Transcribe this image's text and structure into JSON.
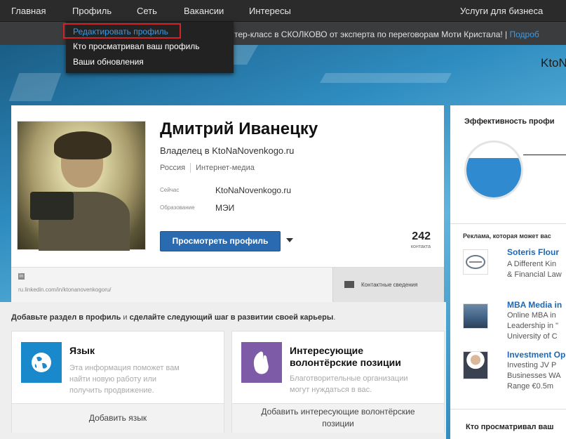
{
  "nav": {
    "items": [
      "Главная",
      "Профиль",
      "Сеть",
      "Вакансии",
      "Интересы"
    ],
    "business": "Услуги для бизнеса"
  },
  "ticker": {
    "text": "тер-класс в СКОЛКОВО от эксперта по переговорам Моти Кристала! |",
    "link": "Подроб"
  },
  "dropdown": {
    "items": [
      "Редактировать профиль",
      "Кто просматривал ваш профиль",
      "Ваши обновления"
    ],
    "highlight_color": "#d0232a"
  },
  "banner": {
    "brand_text": "KtoNa"
  },
  "profile": {
    "name": "Дмитрий Иванецку",
    "headline": "Владелец в KtoNaNovenkogo.ru",
    "location": "Россия",
    "industry": "Интернет-медиа",
    "current_label": "Сейчас",
    "current_value": "KtoNaNovenkogo.ru",
    "education_label": "Образование",
    "education_value": "МЭИ",
    "view_button": "Просмотреть профиль",
    "connections_count": "242",
    "connections_label": "контакта",
    "linkedin_icon": "in",
    "public_url": "ru.linkedin.com/in/ktonanovenkogoru/",
    "contact_info": "Контактные сведения"
  },
  "suggestions": {
    "lead_bold_1": "Добавьте раздел в профиль",
    "lead_mid": " и ",
    "lead_bold_2": "сделайте следующий шаг в развитии своей карьеры",
    "lead_end": ".",
    "cards": [
      {
        "icon": "globe-icon",
        "title": "Язык",
        "desc": [
          "Эта информация поможет вам",
          "найти новую работу или",
          "получить продвижение."
        ],
        "footer": "Добавить язык",
        "color": "#1a89cc"
      },
      {
        "icon": "raised-hand-icon",
        "title": [
          "Интересующие",
          "волонтёрские позиции"
        ],
        "desc": [
          "Благотворительные организации",
          "могут нуждаться в вас."
        ],
        "footer": [
          "Добавить интересующие волонтёрские",
          "позиции"
        ],
        "color": "#7e5ba6"
      }
    ]
  },
  "sidebar": {
    "effectiveness_title": "Эффективность профи",
    "ads_title": "Реклама, которая может вас",
    "ads": [
      {
        "title": "Soteris Flour",
        "lines": [
          "A Different Kin",
          "& Financial Law"
        ]
      },
      {
        "title": "MBA Media in",
        "lines": [
          "Online MBA in",
          "Leadership in \"",
          "University of C"
        ]
      },
      {
        "title": "Investment Op",
        "lines": [
          "Investing JV P",
          "Businesses WA",
          "Range €0.5m"
        ]
      }
    ],
    "viewers_title": "Кто просматривал ваш"
  }
}
